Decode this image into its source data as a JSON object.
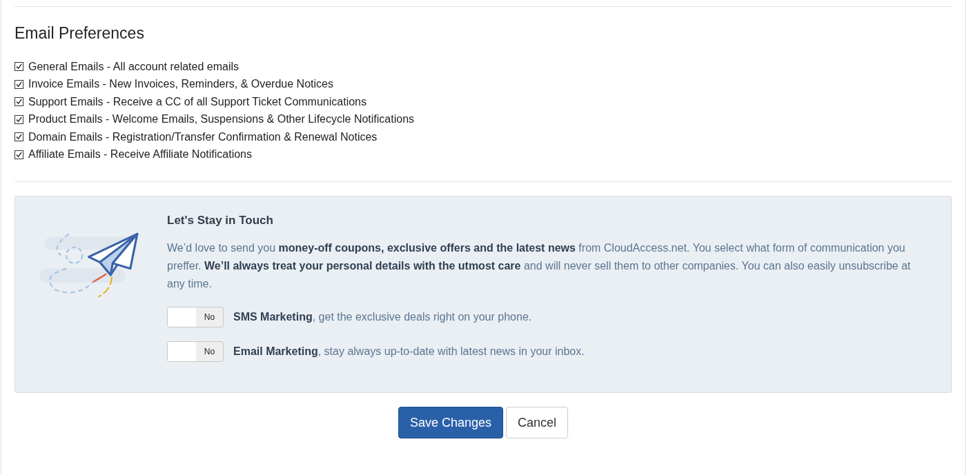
{
  "email_preferences": {
    "title": "Email Preferences",
    "options": [
      {
        "label": "General Emails - All account related emails",
        "checked": true
      },
      {
        "label": "Invoice Emails - New Invoices, Reminders, & Overdue Notices",
        "checked": true
      },
      {
        "label": "Support Emails - Receive a CC of all Support Ticket Communications",
        "checked": true
      },
      {
        "label": "Product Emails - Welcome Emails, Suspensions & Other Lifecycle Notifications",
        "checked": true
      },
      {
        "label": "Domain Emails - Registration/Transfer Confirmation & Renewal Notices",
        "checked": true
      },
      {
        "label": "Affiliate Emails - Receive Affiliate Notifications",
        "checked": true
      }
    ]
  },
  "stay_in_touch": {
    "title": "Let's Stay in Touch",
    "description": "We’d love to send you **money-off coupons, exclusive offers and the latest news** from CloudAccess.net. You select what form of communication you preffer. **We’ll always treat your personal details with the utmost care** and will never sell them to other companies. You can also easily unsubscribe at any time.",
    "marketing": [
      {
        "toggle_label": "No",
        "on": false,
        "text": "**SMS Marketing**, get the exclusive deals right on your phone."
      },
      {
        "toggle_label": "No",
        "on": false,
        "text": "**Email Marketing**, stay always up-to-date with latest news in your inbox."
      }
    ]
  },
  "buttons": [
    {
      "label": "Save Changes",
      "kind": "primary"
    },
    {
      "label": "Cancel",
      "kind": "secondary"
    }
  ]
}
